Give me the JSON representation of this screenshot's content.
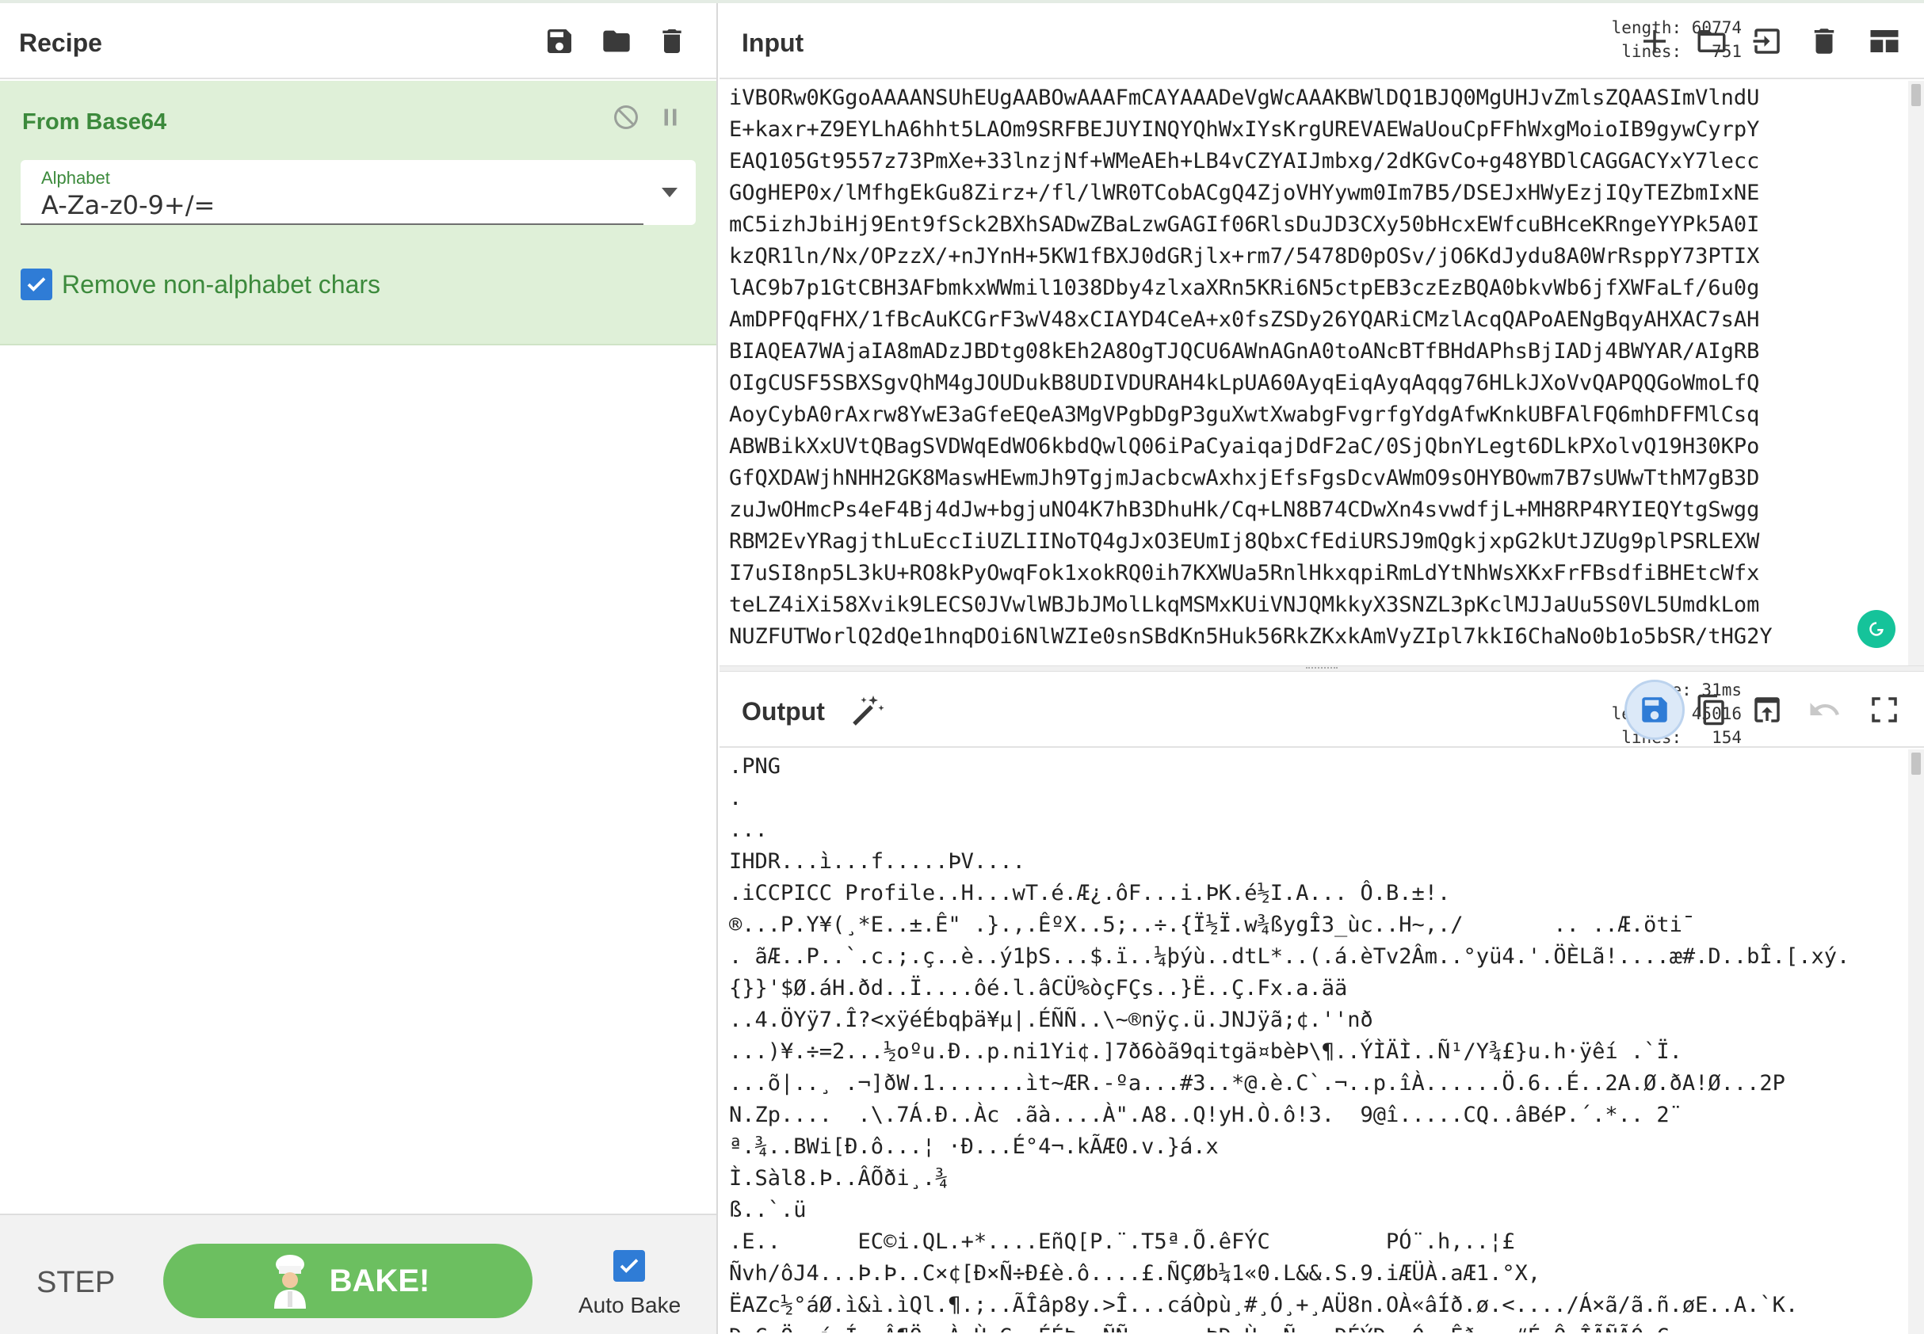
{
  "recipe": {
    "title": "Recipe",
    "header_icons": [
      "save-icon",
      "folder-icon",
      "trash-icon"
    ],
    "operation": {
      "name": "From Base64",
      "icons": [
        "disable-icon",
        "pause-icon"
      ],
      "alphabet_label": "Alphabet",
      "alphabet_value": "A-Za-z0-9+/=",
      "remove_nonalpha_label": "Remove non-alphabet chars",
      "remove_nonalpha_checked": true
    },
    "controls": {
      "step_label": "STEP",
      "bake_label": "BAKE!",
      "autobake_label": "Auto Bake",
      "autobake_checked": true,
      "accent_color": "#6cbf60"
    }
  },
  "input": {
    "title": "Input",
    "length_key": "length:",
    "length_value": "60774",
    "lines_key": "lines:",
    "lines_value": "751",
    "icons": [
      "add-icon",
      "folder-icon",
      "import-icon",
      "trash-icon",
      "layout-icon"
    ],
    "lines": [
      "iVBORw0KGgoAAAANSUhEUgAABOwAAAFmCAYAAADeVgWcAAAKBWlDQ1BJQ0MgUHJvZmlsZQAASImVlndU",
      "E+kaxr+Z9EYLhA6hht5LAOm9SRFBEJUYINQYQhWxIYsKrgUREVAEWaUouCpFFhWxgMoioIB9gywCyrpY",
      "EAQ105Gt9557z73PmXe+33lnzjNf+WMeAEh+LB4vCZYAIJmbxg/2dKGvCo+g48YBDlCAGGACYxY7lecc",
      "GOgHEP0x/lMfhgEkGu8Zirz+/fl/lWR0TCobACgQ4ZjoVHYywm0Im7B5/DSEJxHWyEzjIQyTEZbmIxNE",
      "mC5izhJbiHj9Ent9fSck2BXhSADwZBaLzwGAGIf06RlsDuJD3CXy50bHcxEWfcuBHceKRngeYYPk5A0I",
      "kzQR1ln/Nx/OPzzX/+nJYnH+5KW1fBXJ0dGRjlx+rm7/5478D0pOSv/jO6KdJydu8A0WrRsppY73PTIX",
      "lAC9b7p1GtCBH3AFbmkxWWmil1038Dby4zlxaXRn5KRi6N5ctpEB3czEzBQA0bkvWb6jfXWFaLf/6u0g",
      "AmDPFQqFHX/1fBcAuKCGrF3wV48xCIAYD4CeA+x0fsZSDy26YQARiCMzlAcqQAPoAENgBqyAHXAC7sAH",
      "BIAQEA7WAjaIA8mADzJBDtg08kEh2A8OgTJQCU6AWnAGnA0toANcBTfBHdAPhsBjIADj4BWYAR/AIgRB",
      "OIgCUSF5SBXSgvQhM4gJOUDukB8UDIVDURAH4kLpUA60AyqEiqAyqAqqg76HLkJXoVvQAPQQGoWmoLfQ",
      "AoyCybA0rAxrw8YwE3aGfeEQeA3MgVPgbDgP3guXwtXwabgFvgrfgYdgAfwKnkUBFAlFQ6mhDFFMlCsq",
      "ABWBikXxUVtQBagSVDWqEdWO6kbdQwlQ06iPaCyaiqajDdF2aC/0SjQbnYLegt6DLkPXolvQ19H30KPo",
      "GfQXDAWjhNHH2GK8MaswHEwmJh9TgjmJacbcwAxhxjEfsFgsDcvAWmO9sOHYBOwm7B7sUWwTthM7gB3D",
      "zuJwOHmcPs4eF4Bj4dJw+bgjuNO4K7hB3DhuHk/Cq+LN8B74CDwXn4svwdfjL+MH8RP4RYIEQYtgSwgg",
      "RBM2EvYRagjthLuEccIiUZLIINoTQ4gJxO3EUmIj8QbxCfEdiURSJ9mQgkjxpG2kUtJZUg9plPSRLEXW",
      "I7uSI8np5L3kU+RO8kPyOwqFok1xokRQ0ih7KXWUa5RnlHkxqpiRmLdYtNhWsXKxFrFBsdfiBHEtcWfx",
      "teLZ4iXi58Xvik9LECS0JVwlWBJbJMolLkqMSMxKUiVNJQMkkyX3SNZL3pKclMJJaUu5S0VL5UmdkLom",
      "NUZFUTWorlQ2dQe1hnqDOi6NlWZIe0snSBdKn5Huk56RkZKxkAmVyZIpl7kkI6ChaNo0b1o5bSR/tHG2Y"
    ],
    "scroll_color": "#c4c4c4"
  },
  "output": {
    "title": "Output",
    "time_key": "time:",
    "time_value": "31ms",
    "length_key": "length:",
    "length_value": "45016",
    "lines_key": "lines:",
    "lines_value": "154",
    "icons": [
      "magic-wand-icon",
      "save-icon",
      "copy-icon",
      "replace-input-icon",
      "undo-icon",
      "fullscreen-icon"
    ],
    "lines": [
      ".PNG",
      ".",
      "...",
      "IHDR...ì...f.....ÞV....",
      ".iCCPICC Profile..H...wT.é.Æ¿.ôF...i.ÞK.é½I.A... Ô.B.±!.",
      "®...P.Y¥(¸*E..±.Ê\" .}.,.ÊºX..5;..÷.{Ï½Ï.w¾ßygÎ3_ùc..H~,./       .. ..Æ.öti¯",
      ". ãÆ..P..`.c.;.ç..è..ý1þS...$.ï..¼þýù..dtL*..(.á.èTv2Âm..°yü4.'.ÖÈLã!....æ#.D..bÎ.[.xý.",
      "{}}'$Ø.áH.ðd..Ï....ôé.l.âCÜ%òçFÇs..}Ë..Ç.Fx.a.ää",
      "..4.ÖYÿ7.Î?<xÿéÉbqþä¥µ|.ÉÑÑ..\\~®nÿç.ü.JNJÿã;¢.''nð",
      "...)¥.÷=2...½oºu.Ð..p.ni1Yi¢.]7ð6òã9qitgä¤bèÞ\\¶..ÝÌÄÌ..Ñ¹/Y¾£}u.h·ÿêí .`Ï.",
      "...õ|..¸ .¬]ðW.1.......ìt~ÆR.-ºa...#3..*@.è.C`.¬..p.îÀ......Ö.6..É..2A.Ø.ðA!Ø...2P",
      "N.Zp....  .\\.7Á.Ð..Àc .ãà....À\".A8..Q!yH.Ò.ô!3.  9@î.....CQ..âBéP.´.*.. 2¨",
      "ª.¾..BWi[Ð.ô...¦ ·Ð...É°4¬.kÃÆ0.v.}á.x",
      "Ì.Sàl8.Þ..ÂÕði¸.¾",
      "ß..`.ü",
      ".E..      EC©i.QL.+*....EñQ[P.¨.T5ª.Õ.êFÝC         PÓ¨.h,..¦£",
      "Ñvh/ôJ4...Þ.Þ..C×¢[Ð×Ñ÷Ð£è.ô....£.ÑÇØb¼1«0.L&&.S.9.iÆÜÀ.aÆ1.°X,",
      "ËAZc½°áØ.ì&ì.ìQl.¶.;..ÃÎâp8y.>Î...cáÒpù¸#¸Ó¸+¸AÜ8n.OÀ«âÍð.ø.<..../Á×ã/ã.ñ.øE..A.`K.",
      "Ð.Ç.Ö..í.Í..Â¶Ö..À.Ù.G..ÉÉÞ..ÑÑ..  ..ÞÐ.Ù..Ñ...ÐÉÝÐ..Ó..Êð...#É.Ô.ÎÃÑÃÓ.Ç"
    ]
  }
}
